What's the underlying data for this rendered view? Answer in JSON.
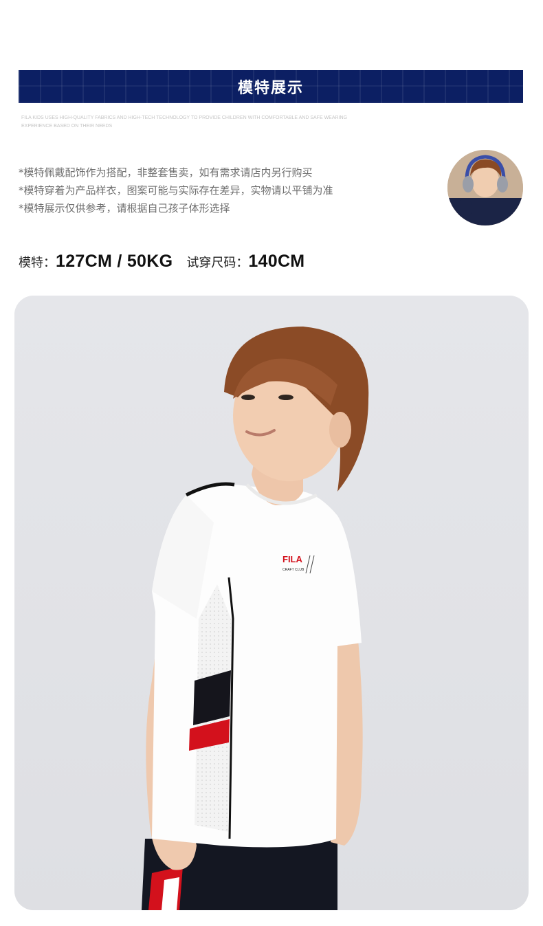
{
  "banner": {
    "title": "模特展示",
    "subtext": "FILA KIDS USES HIGH-QUALITY FABRICS AND HIGH-TECH TECHNOLOGY TO PROVIDE CHILDREN WITH COMFORTABLE AND SAFE WEARING EXPERIENCE BASED ON THEIR NEEDS"
  },
  "notes": [
    "*模特佩戴配饰作为搭配，非整套售卖，如有需求请店内另行购买",
    "*模特穿着为产品样衣，图案可能与实际存在差异，实物请以平铺为准",
    "*模特展示仅供参考，请根据自己孩子体形选择"
  ],
  "model": {
    "label": "模特：",
    "value": "127CM / 50KG",
    "size_label": "试穿尺码：",
    "size_value": "140CM"
  },
  "photo": {
    "logo_text": "FILA",
    "logo_sub": "CRAFT CLUB"
  },
  "colors": {
    "banner": "#0c1f63",
    "accent_red": "#d3111c",
    "shirt": "#ffffff",
    "background": "#e6e7ea"
  }
}
